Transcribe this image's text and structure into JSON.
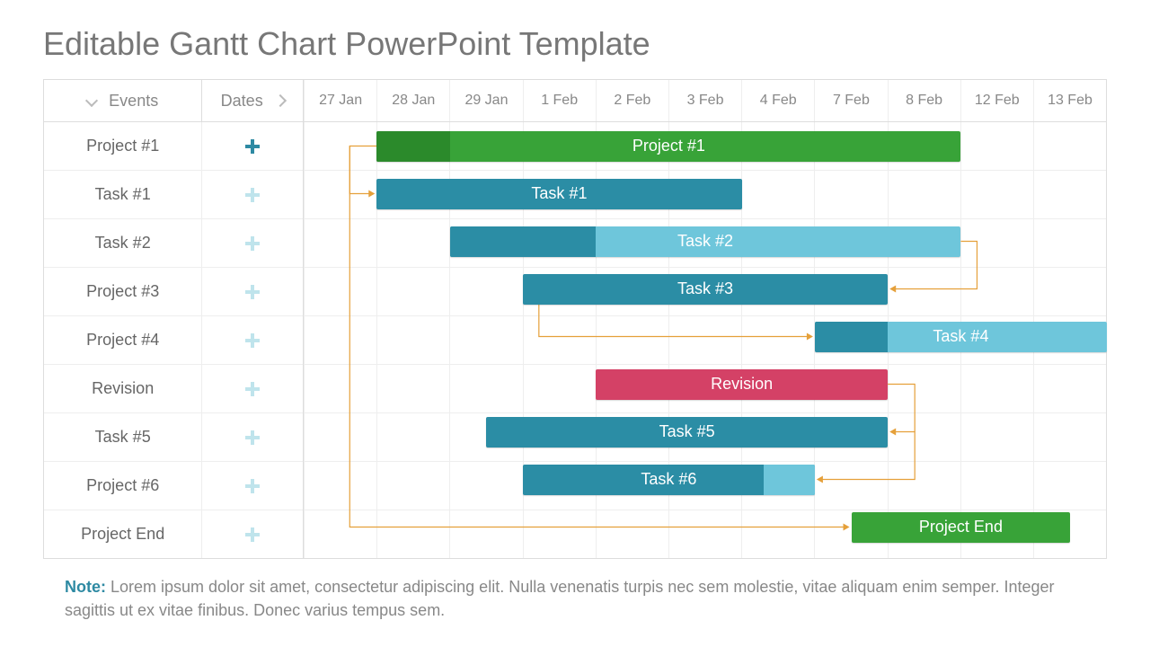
{
  "title": "Editable Gantt Chart PowerPoint Template",
  "headers": {
    "events": "Events",
    "dates": "Dates"
  },
  "dateCols": [
    "27 Jan",
    "28 Jan",
    "29 Jan",
    "1 Feb",
    "2 Feb",
    "3 Feb",
    "4 Feb",
    "7 Feb",
    "8 Feb",
    "12 Feb",
    "13 Feb"
  ],
  "rows": [
    {
      "label": "Project #1",
      "plus": "dark"
    },
    {
      "label": "Task #1",
      "plus": "light"
    },
    {
      "label": "Task #2",
      "plus": "light"
    },
    {
      "label": "Project #3",
      "plus": "light"
    },
    {
      "label": "Project #4",
      "plus": "light"
    },
    {
      "label": "Revision",
      "plus": "light"
    },
    {
      "label": "Task #5",
      "plus": "light"
    },
    {
      "label": "Project #6",
      "plus": "light"
    },
    {
      "label": "Project End",
      "plus": "light"
    }
  ],
  "note_label": "Note:",
  "note_text": " Lorem ipsum dolor sit amet, consectetur adipiscing elit. Nulla venenatis turpis nec sem molestie, vitae aliquam enim semper. Integer sagittis ut ex vitae finibus. Donec varius tempus sem.",
  "colors": {
    "green": "#38a338",
    "greenDark": "#2b8a2b",
    "teal": "#2b8da5",
    "tealLight": "#6ec6db",
    "pink": "#d44166",
    "orange": "#e5a03a"
  },
  "chart_data": {
    "type": "bar",
    "orientation": "horizontal-gantt",
    "date_columns": [
      "27 Jan",
      "28 Jan",
      "29 Jan",
      "1 Feb",
      "2 Feb",
      "3 Feb",
      "4 Feb",
      "7 Feb",
      "8 Feb",
      "12 Feb",
      "13 Feb"
    ],
    "tasks": [
      {
        "row": 0,
        "label": "Project #1",
        "start": 1,
        "end": 9,
        "color": "green",
        "progress_end": 2
      },
      {
        "row": 1,
        "label": "Task #1",
        "start": 1,
        "end": 6,
        "color": "teal"
      },
      {
        "row": 2,
        "label": "Task #2",
        "start": 2,
        "end": 9,
        "color": "tealLight",
        "progress_color": "teal",
        "progress_end": 4
      },
      {
        "row": 3,
        "label": "Task #3",
        "start": 3,
        "end": 8,
        "color": "teal"
      },
      {
        "row": 4,
        "label": "Task #4",
        "start": 7,
        "end": 11,
        "color": "tealLight",
        "progress_color": "teal",
        "progress_end": 8
      },
      {
        "row": 5,
        "label": "Revision",
        "start": 4,
        "end": 8,
        "color": "pink"
      },
      {
        "row": 6,
        "label": "Task #5",
        "start": 2.5,
        "end": 8,
        "color": "teal"
      },
      {
        "row": 7,
        "label": "Task #6",
        "start": 3,
        "end": 7,
        "color": "teal",
        "tail_color": "tealLight",
        "tail_start": 6.3
      },
      {
        "row": 8,
        "label": "Project End",
        "start": 7.5,
        "end": 10.5,
        "color": "green"
      }
    ],
    "dependencies": [
      {
        "from_row": 0,
        "from_side": "start",
        "to_row": 1,
        "to_side": "start"
      },
      {
        "from_row": 0,
        "from_side": "start",
        "to_row": 8,
        "to_side": "start-vertical"
      },
      {
        "from_row": 2,
        "from_side": "end",
        "to_row": 4,
        "to_side": "start-below"
      },
      {
        "from_row": 3,
        "from_side": "end",
        "to_row": 3,
        "note": "arrow-in"
      },
      {
        "from_row": 3,
        "from_side": "start-below",
        "to_row": 4,
        "to_side": "start"
      },
      {
        "from_row": 5,
        "from_side": "end",
        "to_row": 6,
        "to_side": "end"
      },
      {
        "from_row": 5,
        "from_side": "end",
        "to_row": 7,
        "to_side": "end"
      }
    ]
  }
}
